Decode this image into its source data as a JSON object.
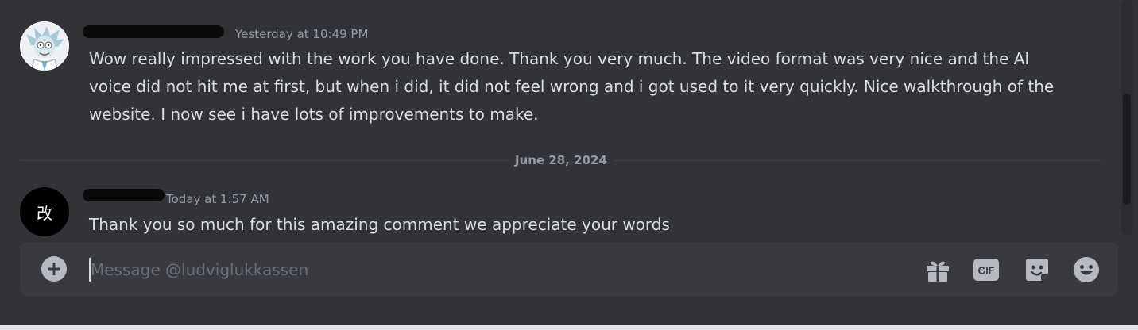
{
  "messages": [
    {
      "timestamp": "Yesterday at 10:49 PM",
      "text": "Wow really impressed with the work you have done. Thank you very much. The video format was very nice and the AI voice did not hit me at first, but when i did, it did not feel wrong and i got used to it very quickly. Nice walkthrough of the website. I now see i have lots of improvements to make."
    },
    {
      "avatar_text": "改",
      "timestamp": "Today at 1:57 AM",
      "text": "Thank you so much for this amazing comment we appreciate your words"
    }
  ],
  "divider": {
    "date": "June 28, 2024"
  },
  "composer": {
    "placeholder": "Message @ludviglukkassen",
    "gif_label": "GIF"
  },
  "colors": {
    "background": "#313338",
    "composer": "#383a40",
    "text": "#dbdee1",
    "muted": "#949ba4",
    "icon": "#b5bac1"
  },
  "icons": [
    "plus-circle-icon",
    "gift-icon",
    "gif-icon",
    "sticker-icon",
    "emoji-icon"
  ]
}
